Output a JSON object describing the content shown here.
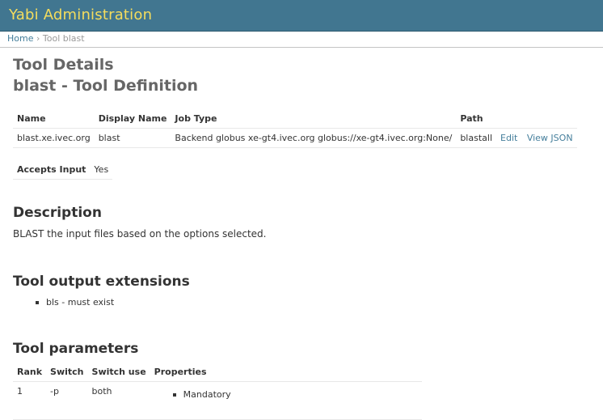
{
  "header": {
    "title": "Yabi Administration"
  },
  "breadcrumb": {
    "home": "Home",
    "separator": "›",
    "current": "Tool blast"
  },
  "page": {
    "title": "Tool Details",
    "subtitle": "blast - Tool Definition"
  },
  "tool_table": {
    "headers": [
      "Name",
      "Display Name",
      "Job Type",
      "Path"
    ],
    "row": {
      "name": "blast.xe.ivec.org",
      "display_name": "blast",
      "job_type": "Backend globus xe-gt4.ivec.org globus://xe-gt4.ivec.org:None/",
      "path": "blastall",
      "edit_label": "Edit",
      "view_json_label": "View JSON"
    }
  },
  "accepts_input": {
    "label": "Accepts Input",
    "value": "Yes"
  },
  "description": {
    "heading": "Description",
    "text": "BLAST the input files based on the options selected."
  },
  "output_extensions": {
    "heading": "Tool output extensions",
    "items": [
      "bls - must exist"
    ]
  },
  "parameters": {
    "heading": "Tool parameters",
    "headers": [
      "Rank",
      "Switch",
      "Switch use",
      "Properties"
    ],
    "rows": [
      {
        "rank": "1",
        "switch": "-p",
        "switch_use": "both",
        "properties": [
          "Mandatory"
        ]
      }
    ]
  },
  "colors": {
    "header_bg": "#417690",
    "header_title": "#f5dd5d",
    "link": "#447e9b"
  }
}
